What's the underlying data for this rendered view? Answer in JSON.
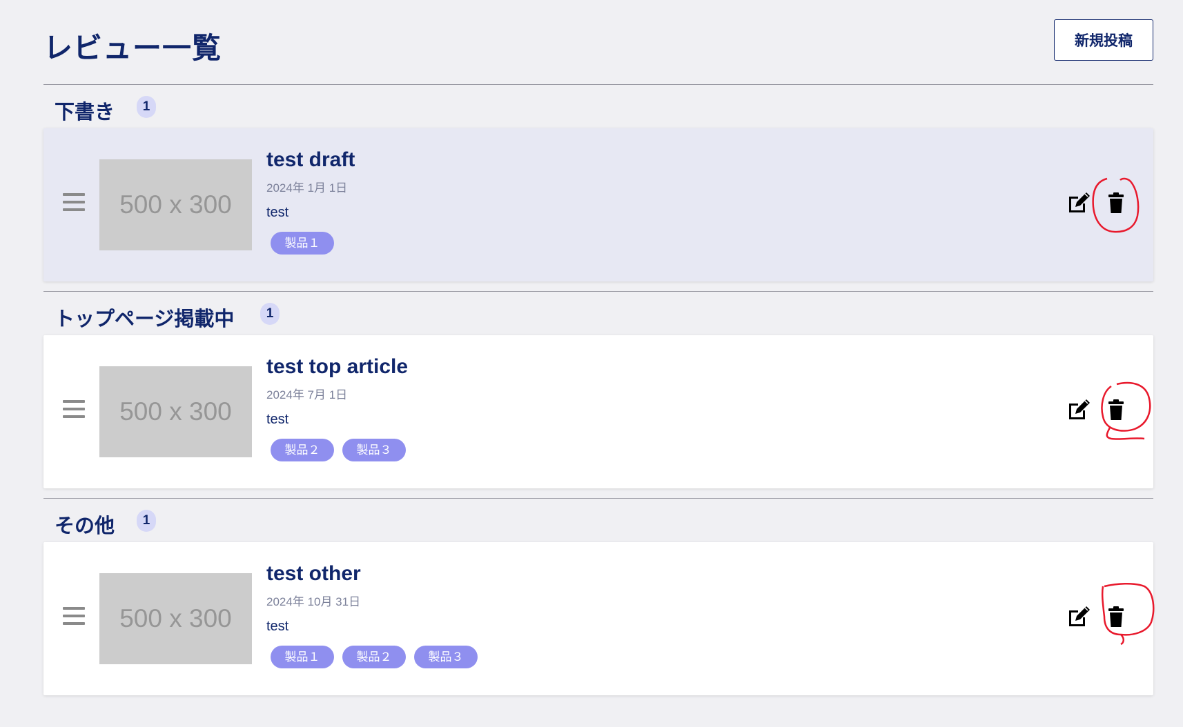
{
  "page": {
    "title": "レビュー一覧",
    "new_post_label": "新規投稿"
  },
  "sections": [
    {
      "title": "下書き",
      "count": "1",
      "items": [
        {
          "title": "test draft",
          "date": "2024年 1月 1日",
          "text": "test",
          "image_placeholder": "500 x 300",
          "tags": [
            "製品１"
          ]
        }
      ]
    },
    {
      "title": "トップページ掲載中",
      "count": "1",
      "items": [
        {
          "title": "test top article",
          "date": "2024年 7月 1日",
          "text": "test",
          "image_placeholder": "500 x 300",
          "tags": [
            "製品２",
            "製品３"
          ]
        }
      ]
    },
    {
      "title": "その他",
      "count": "1",
      "items": [
        {
          "title": "test other",
          "date": "2024年 10月 31日",
          "text": "test",
          "image_placeholder": "500 x 300",
          "tags": [
            "製品１",
            "製品２",
            "製品３"
          ]
        }
      ]
    }
  ],
  "icons": {
    "drag": "hamburger-drag-handle-icon",
    "edit": "edit-icon",
    "delete": "trash-icon"
  },
  "colors": {
    "background": "#f0f0f3",
    "primary_text": "#10266b",
    "draft_card": "#e7e8f3",
    "tag": "#8f8fef",
    "badge": "#d6d8f7",
    "annotation": "#e8192c"
  }
}
